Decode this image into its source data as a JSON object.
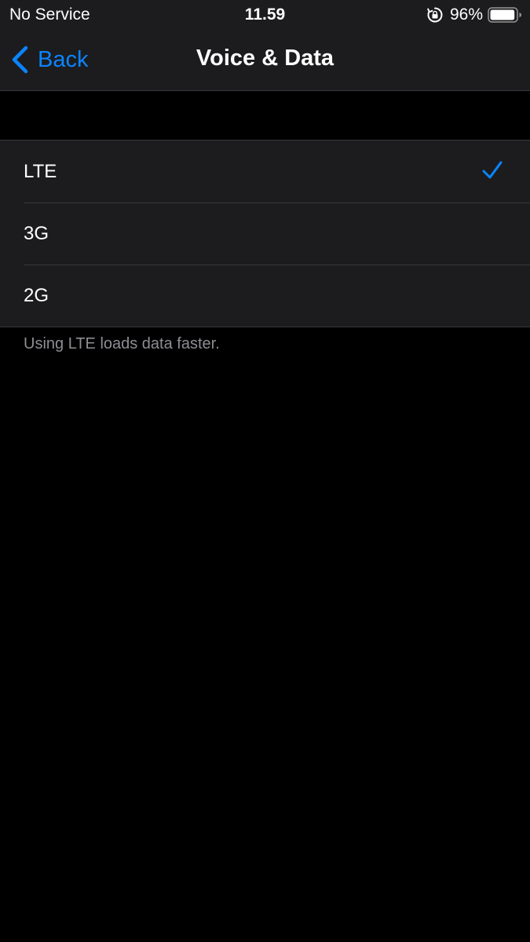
{
  "status_bar": {
    "carrier": "No Service",
    "time": "11.59",
    "orientation_lock_icon": "orientation-lock-icon",
    "battery_percent": "96%",
    "battery_level": 0.96,
    "battery_icon": "battery-icon"
  },
  "nav": {
    "back_label": "Back",
    "back_icon": "chevron-left-icon",
    "title": "Voice & Data"
  },
  "options": [
    {
      "label": "LTE",
      "selected": true
    },
    {
      "label": "3G",
      "selected": false
    },
    {
      "label": "2G",
      "selected": false
    }
  ],
  "footer_note": "Using LTE loads data faster.",
  "colors": {
    "accent": "#0a84ff",
    "background": "#000000",
    "cell_background": "#1c1c1e",
    "separator": "#38383a",
    "secondary_text": "#8d8d93"
  }
}
